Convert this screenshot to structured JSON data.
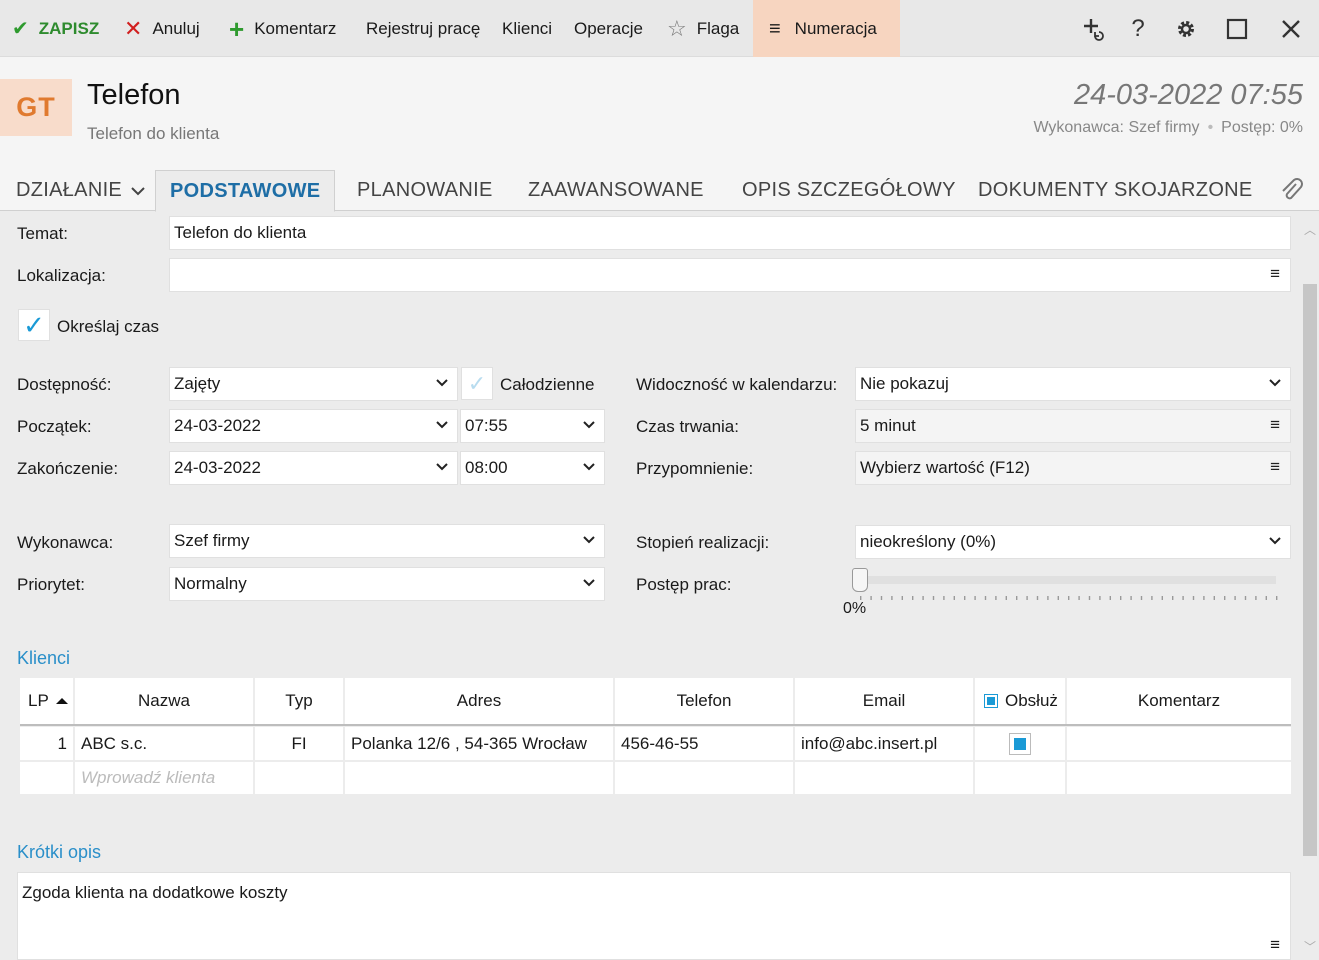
{
  "toolbar": {
    "save": "ZAPISZ",
    "cancel": "Anuluj",
    "comment": "Komentarz",
    "register": "Rejestruj pracę",
    "clients": "Klienci",
    "operations": "Operacje",
    "flag": "Flaga",
    "numbering": "Numeracja",
    "icons": [
      "add-task-icon",
      "help-icon",
      "gear-icon",
      "maximize-icon",
      "close-icon"
    ],
    "help_glyph": "?"
  },
  "header": {
    "avatar": "GT",
    "title": "Telefon",
    "subtitle": "Telefon do klienta",
    "date": "24-03-2022 07:55",
    "executor": "Wykonawca: Szef firmy",
    "progress": "Postęp: 0%"
  },
  "tabs": {
    "action": "DZIAŁANIE",
    "items": [
      "PODSTAWOWE",
      "PLANOWANIE",
      "ZAAWANSOWANE",
      "OPIS SZCZEGÓŁOWY",
      "DOKUMENTY SKOJARZONE"
    ],
    "active": "PODSTAWOWE"
  },
  "form": {
    "subject_label": "Temat:",
    "subject_value": "Telefon do klienta",
    "location_label": "Lokalizacja:",
    "location_value": "",
    "time_check_label": "Określaj czas",
    "availability_label": "Dostępność:",
    "availability_value": "Zajęty",
    "all_day_label": "Całodzienne",
    "start_label": "Początek:",
    "start_date": "24-03-2022",
    "start_time": "07:55",
    "end_label": "Zakończenie:",
    "end_date": "24-03-2022",
    "end_time": "08:00",
    "visibility_label": "Widoczność w kalendarzu:",
    "visibility_value": "Nie pokazuj",
    "duration_label": "Czas trwania:",
    "duration_value": "5 minut",
    "reminder_label": "Przypomnienie:",
    "reminder_value": "Wybierz wartość (F12)",
    "executor_label": "Wykonawca:",
    "executor_value": "Szef firmy",
    "priority_label": "Priorytet:",
    "priority_value": "Normalny",
    "realization_label": "Stopień realizacji:",
    "realization_value": "nieokreślony  (0%)",
    "progress_label": "Postęp prac:",
    "progress_value": "0%",
    "progress_fraction": 0
  },
  "clients": {
    "section_title": "Klienci",
    "columns": [
      "LP",
      "Nazwa",
      "Typ",
      "Adres",
      "Telefon",
      "Email",
      "Obsłuż",
      "Komentarz"
    ],
    "rows": [
      {
        "lp": "1",
        "name": "ABC s.c.",
        "type": "FI",
        "address": "Polanka  12/6 , 54-365 Wrocław",
        "phone": "456-46-55",
        "email": "info@abc.insert.pl",
        "served": true,
        "comment": ""
      }
    ],
    "new_placeholder": "Wprowadź klienta"
  },
  "short_desc": {
    "section_title": "Krótki opis",
    "text": "Zgoda klienta na dodatkowe koszty"
  },
  "colors": {
    "accent": "#1a9ad6",
    "save_green": "#2e8b2e",
    "cancel_red": "#d11f1f",
    "numbering_bg": "#f7d5c0",
    "avatar_text": "#e07a2f"
  }
}
